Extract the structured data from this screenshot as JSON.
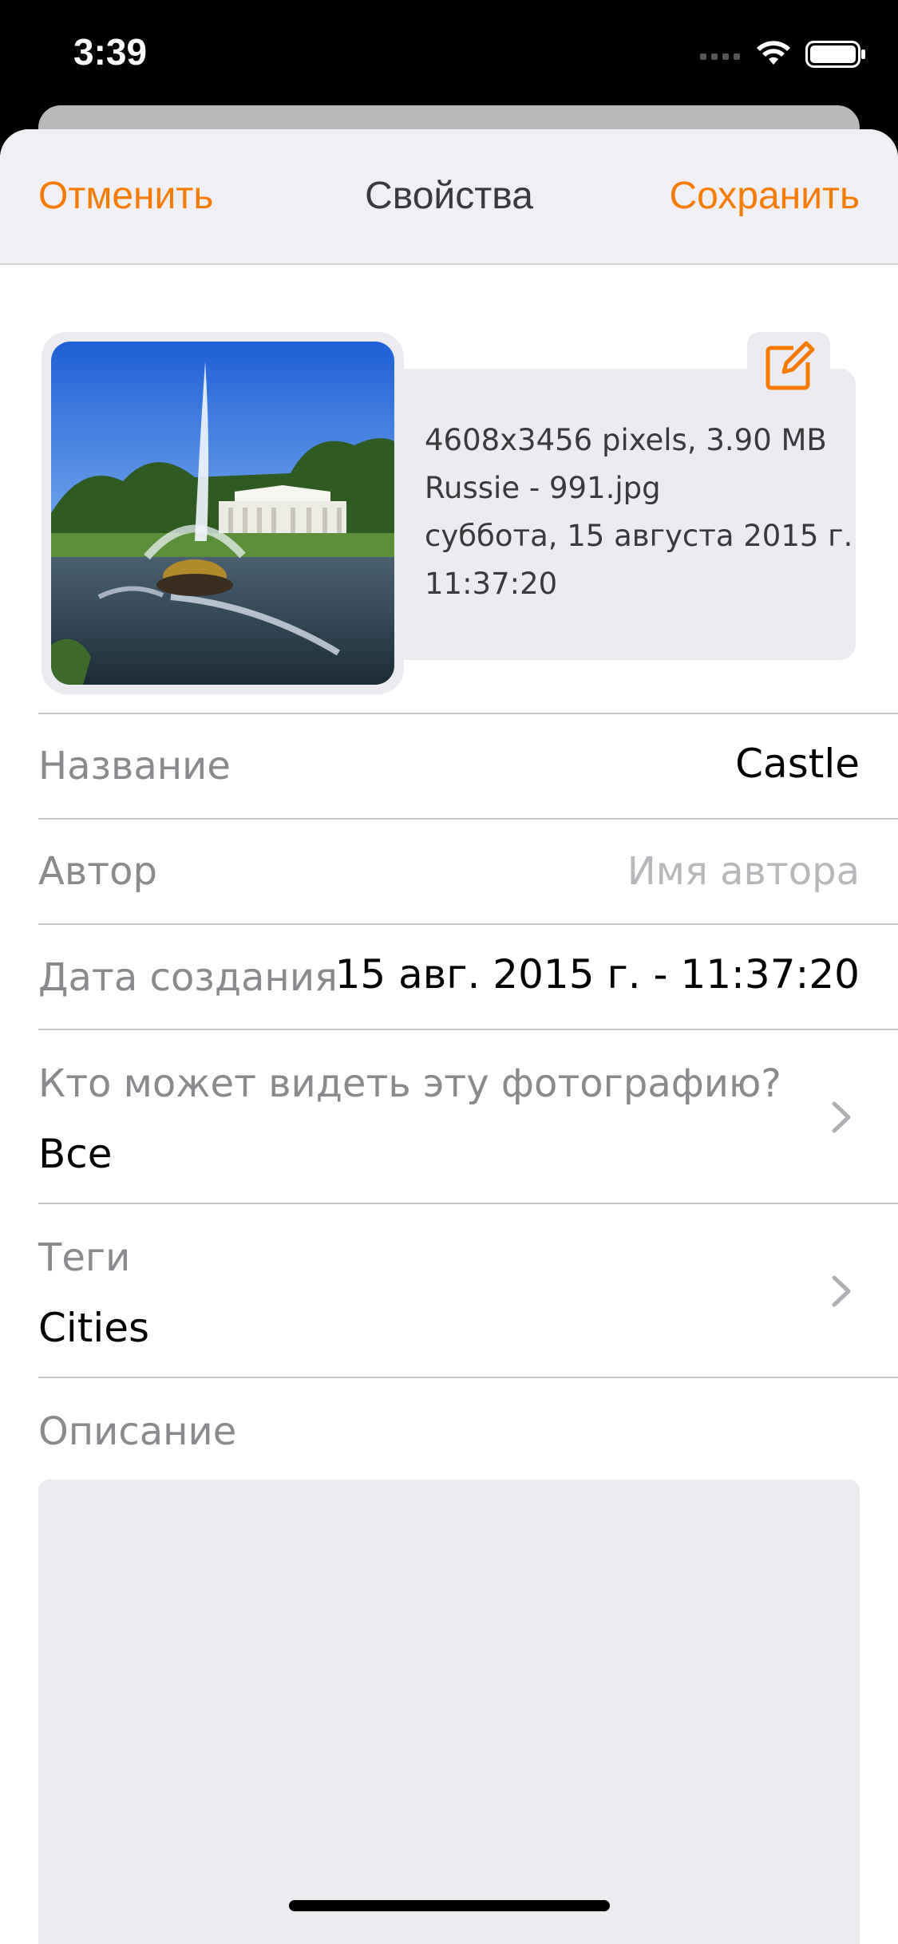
{
  "status_bar": {
    "time": "3:39"
  },
  "nav": {
    "cancel_label": "Отменить",
    "title": "Свойства",
    "save_label": "Сохранить"
  },
  "photo": {
    "meta_line_1": "4608x3456 pixels, 3.90 MB",
    "meta_line_2": "Russie - 991.jpg",
    "meta_line_3": "суббота, 15 августа 2015 г.",
    "meta_line_4": "11:37:20"
  },
  "fields": {
    "title_label": "Название",
    "title_value": "Castle",
    "author_label": "Автор",
    "author_placeholder": "Имя автора",
    "date_label": "Дата создания",
    "date_value": "15 авг. 2015 г. - 11:37:20",
    "privacy_label": "Кто может видеть эту фотографию?",
    "privacy_value": "Все",
    "tags_label": "Теги",
    "tags_value": "Cities",
    "description_label": "Описание"
  },
  "icons": [
    "signal-icon",
    "wifi-icon",
    "battery-icon",
    "edit-icon",
    "chevron-right-icon"
  ],
  "colors": {
    "accent": "#f57c00",
    "sheet_bg": "#ffffff",
    "panel_bg": "#ececf0",
    "label_gray": "#8a8a8e"
  }
}
